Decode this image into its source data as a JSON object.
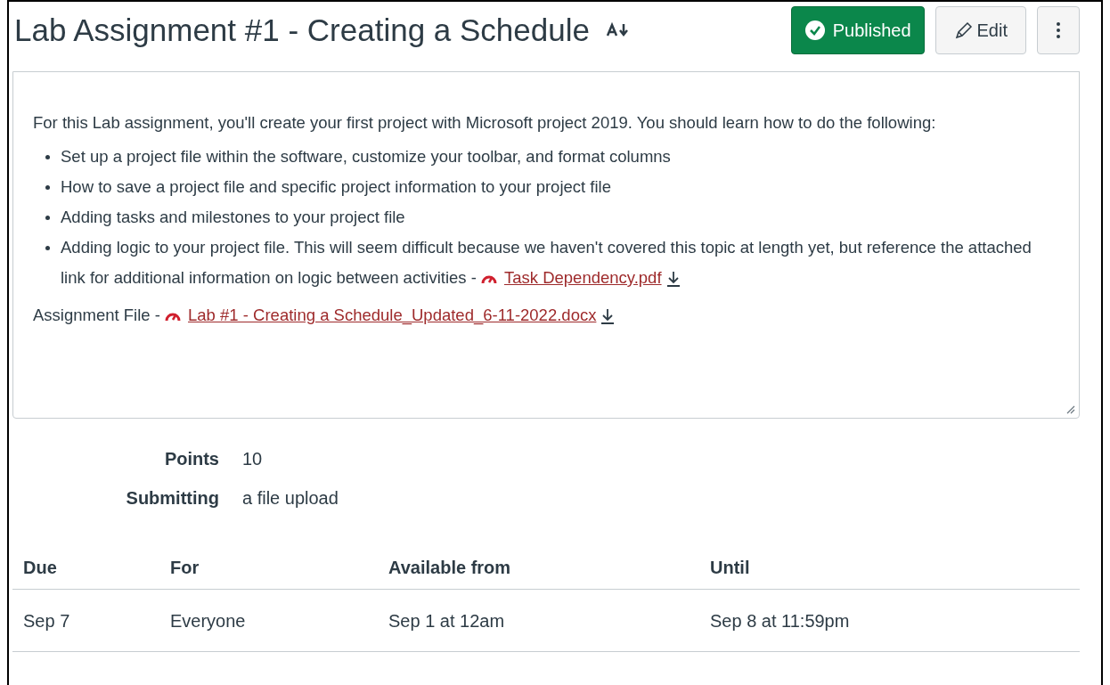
{
  "title": "Lab Assignment #1 - Creating a Schedule",
  "actions": {
    "publish": {
      "label": "Published",
      "published": true
    },
    "edit": {
      "label": "Edit"
    }
  },
  "description": {
    "intro": "For this Lab assignment, you'll create your first project with Microsoft project 2019.  You should learn how to do the following:",
    "bullets": [
      {
        "text": "Set up a project file within the software, customize your toolbar, and format columns"
      },
      {
        "text": "How to save a project file and specific project information to your project file"
      },
      {
        "text": "Adding tasks and milestones to your project file"
      },
      {
        "text": "Adding logic to your project file.  This will seem difficult because we haven't covered this topic at length yet, but reference the attached link for additional information on logic between activities -",
        "link": "Task Dependency.pdf"
      }
    ],
    "file": {
      "label": "Assignment File -",
      "link": "Lab #1 - Creating a Schedule_Updated_6-11-2022.docx"
    }
  },
  "details": [
    {
      "label": "Points",
      "value": "10"
    },
    {
      "label": "Submitting",
      "value": "a file upload"
    }
  ],
  "table": {
    "columns": [
      "Due",
      "For",
      "Available from",
      "Until"
    ],
    "rows": [
      [
        "Sep 7",
        "Everyone",
        "Sep 1 at 12am",
        "Sep 8 at 11:59pm"
      ]
    ]
  }
}
